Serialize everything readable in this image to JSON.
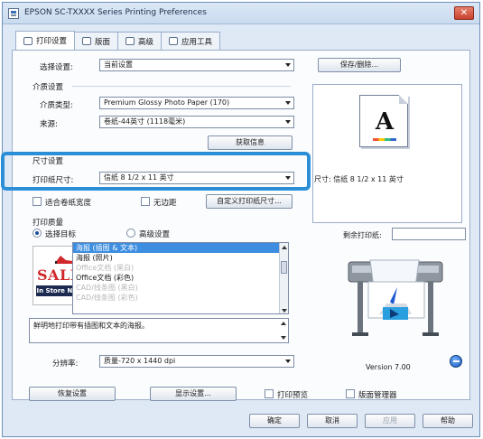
{
  "window": {
    "title": "EPSON SC-TXXXX Series Printing Preferences",
    "close_label": "✕"
  },
  "tabs": [
    {
      "label": "打印设置",
      "icon": "printer-icon"
    },
    {
      "label": "版面",
      "icon": "layout-icon"
    },
    {
      "label": "高级",
      "icon": "advanced-icon"
    },
    {
      "label": "应用工具",
      "icon": "utility-icon"
    }
  ],
  "select_settings": {
    "label": "选择设置:",
    "value": "当前设置",
    "save_delete": "保存/删除..."
  },
  "media": {
    "group": "介质设置",
    "type_label": "介质类型:",
    "type_value": "Premium Glossy Photo Paper (170)",
    "source_label": "来源:",
    "source_value": "卷纸-44英寸 (1118毫米)",
    "get_info": "获取信息"
  },
  "paper_size": {
    "group": "尺寸设置",
    "label": "打印纸尺寸:",
    "value": "信纸 8 1/2 x 11 英寸",
    "fit_roll": "适合卷纸宽度",
    "borderless": "无边距",
    "custom": "自定义打印纸尺寸..."
  },
  "preview": {
    "letter": "A",
    "size_text": "尺寸: 信纸 8 1/2 x 11 英寸",
    "ink_label": "剩余打印纸:",
    "version": "Version 7.00"
  },
  "quality": {
    "group": "打印质量",
    "radio_target": "选择目标",
    "radio_advanced": "高级设置",
    "items": [
      {
        "label": "海报 (插图 & 文本)",
        "state": "selected"
      },
      {
        "label": "海报 (照片)",
        "state": "normal"
      },
      {
        "label": "Office文档 (黑白)",
        "state": "dim"
      },
      {
        "label": "Office文档 (彩色)",
        "state": "normal"
      },
      {
        "label": "CAD/线条图 (黑白)",
        "state": "dim"
      },
      {
        "label": "CAD/线条图 (彩色)",
        "state": "dim"
      }
    ],
    "sale_text": "SALE",
    "store_text": "In Store Now",
    "description": "鲜明地打印带有插图和文本的海报。",
    "resolution_label": "分辨率:",
    "resolution_value": "质量-720 x 1440 dpi"
  },
  "footer": {
    "restore": "恢复设置",
    "show_settings": "显示设置...",
    "print_preview": "打印预览",
    "layout_manager": "版面管理器",
    "ok": "确定",
    "cancel": "取消",
    "apply": "应用",
    "help": "帮助"
  }
}
